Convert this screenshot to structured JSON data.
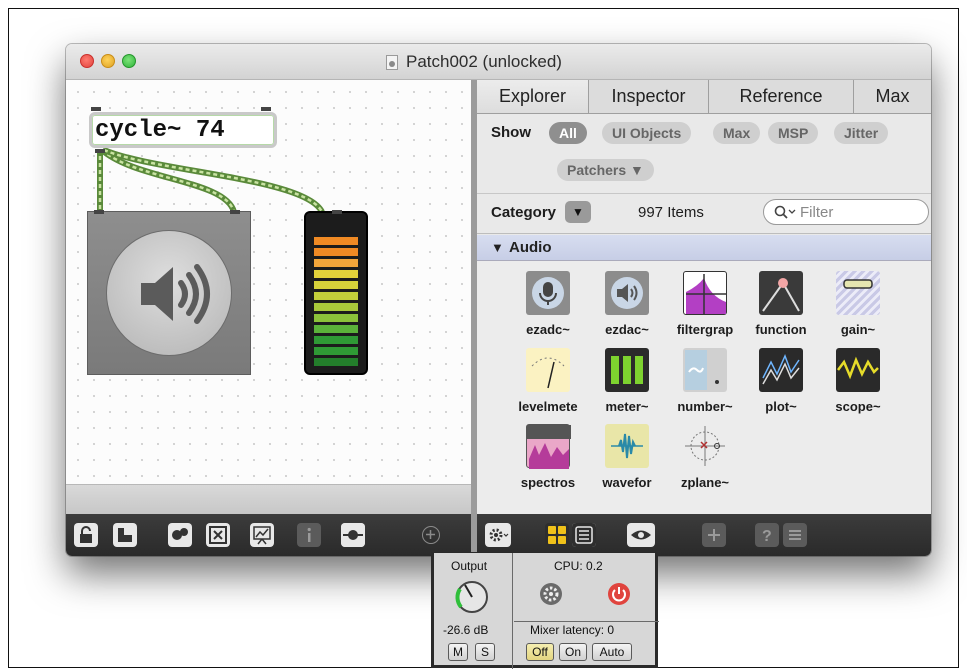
{
  "window": {
    "title": "Patch002 (unlocked)"
  },
  "patcher": {
    "object_text": "cycle~ 74"
  },
  "sidebar": {
    "tabs": [
      "Explorer",
      "Inspector",
      "Reference",
      "Max"
    ],
    "active_tab": "Explorer",
    "show_label": "Show",
    "filters": [
      "All",
      "UI Objects",
      "Max",
      "MSP",
      "Jitter",
      "Patchers ▼"
    ],
    "active_filter": "All",
    "category_label": "Category",
    "category_dropdown": "▼",
    "items_count": "997 Items",
    "filter_placeholder": "Filter",
    "section_title": "Audio",
    "objects": [
      {
        "name": "ezadc~",
        "icon": "microphone-icon"
      },
      {
        "name": "ezdac~",
        "icon": "speaker-icon"
      },
      {
        "name": "filtergrap",
        "icon": "filtergraph-icon"
      },
      {
        "name": "function",
        "icon": "function-icon"
      },
      {
        "name": "gain~",
        "icon": "gain-slider-icon"
      },
      {
        "name": "levelmete",
        "icon": "levelmeter-icon"
      },
      {
        "name": "meter~",
        "icon": "meter-icon"
      },
      {
        "name": "number~",
        "icon": "number-icon"
      },
      {
        "name": "plot~",
        "icon": "plot-icon"
      },
      {
        "name": "scope~",
        "icon": "scope-icon"
      },
      {
        "name": "spectros",
        "icon": "spectroscope-icon"
      },
      {
        "name": "wavefor",
        "icon": "waveform-icon"
      },
      {
        "name": "zplane~",
        "icon": "zplane-icon"
      }
    ]
  },
  "audio_status": {
    "output_label": "Output",
    "output_level": "-26.6 dB",
    "mute_label": "M",
    "solo_label": "S",
    "cpu_label": "CPU:",
    "cpu_value": "0.2",
    "mixer_latency_label": "Mixer latency:",
    "mixer_latency_value": "0",
    "off_label": "Off",
    "on_label": "On",
    "auto_label": "Auto"
  },
  "colors": {
    "accent_selected_box": "#b6d9a8",
    "meter_green": "#2f9a35",
    "meter_yellow": "#cfd23a",
    "meter_orange": "#f08a24",
    "power_red": "#e0443e"
  }
}
